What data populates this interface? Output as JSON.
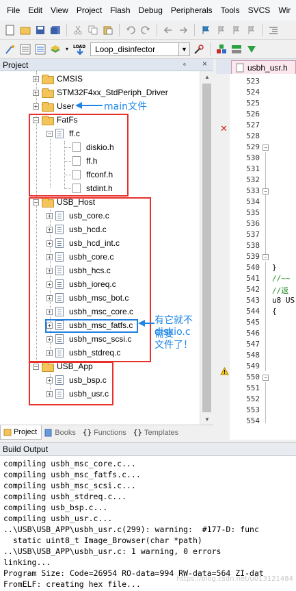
{
  "menu": [
    "File",
    "Edit",
    "View",
    "Project",
    "Flash",
    "Debug",
    "Peripherals",
    "Tools",
    "SVCS",
    "Wir"
  ],
  "toolbar": {
    "target": "Loop_disinfector",
    "load_label": "LOAD"
  },
  "project_panel": {
    "title": "Project",
    "pin_glyph": "ₐ",
    "close_glyph": "×",
    "tree": {
      "cmsis": "CMSIS",
      "stdperiph": "STM32F4xx_StdPeriph_Driver",
      "user": "User",
      "fatfs": {
        "label": "FatFs",
        "ffc": "ff.c",
        "children": [
          "diskio.h",
          "ff.h",
          "ffconf.h",
          "stdint.h"
        ]
      },
      "usb_host": {
        "label": "USB_Host",
        "files": [
          "usb_core.c",
          "usb_hcd.c",
          "usb_hcd_int.c",
          "usbh_core.c",
          "usbh_hcs.c",
          "usbh_ioreq.c",
          "usbh_msc_bot.c",
          "usbh_msc_core.c",
          "usbh_msc_fatfs.c",
          "usbh_msc_scsi.c",
          "usbh_stdreq.c"
        ]
      },
      "usb_app": {
        "label": "USB_App",
        "files": [
          "usb_bsp.c",
          "usbh_usr.c"
        ]
      }
    },
    "annotations": {
      "main": "main文件",
      "diskio_line1": "有它就不需要",
      "diskio_line2": "diskio.c文件了！"
    },
    "tabs": [
      "Project",
      "Books",
      "Functions",
      "Templates"
    ]
  },
  "editor": {
    "tab": "usbh_usr.h",
    "line_numbers": [
      "523",
      "524",
      "525",
      "526",
      "527",
      "528",
      "529",
      "530",
      "531",
      "532",
      "533",
      "534",
      "535",
      "536",
      "537",
      "538",
      "539",
      "540",
      "541",
      "542",
      "543",
      "544",
      "545",
      "546",
      "547",
      "548",
      "549",
      "550",
      "551",
      "552",
      "553",
      "554"
    ],
    "code": {
      "l540": "}",
      "l541": "//~~",
      "l542": "//返",
      "l543": "u8 US",
      "l544": "{"
    }
  },
  "build_output": {
    "title": "Build Output",
    "lines": [
      "compiling usbh_msc_core.c...",
      "compiling usbh_msc_fatfs.c...",
      "compiling usbh_msc_scsi.c...",
      "compiling usbh_stdreq.c...",
      "compiling usb_bsp.c...",
      "compiling usbh_usr.c...",
      "..\\USB\\USB_APP\\usbh_usr.c(299): warning:  #177-D: func",
      "  static uint8_t Image_Browser(char *path)",
      "..\\USB\\USB_APP\\usbh_usr.c: 1 warning, 0 errors",
      "linking...",
      "Program Size: Code=26954 RO-data=994 RW-data=564 ZI-dat",
      "FromELF: creating hex file..."
    ],
    "watermark": "https://blog.csdn.net/u013121484"
  }
}
